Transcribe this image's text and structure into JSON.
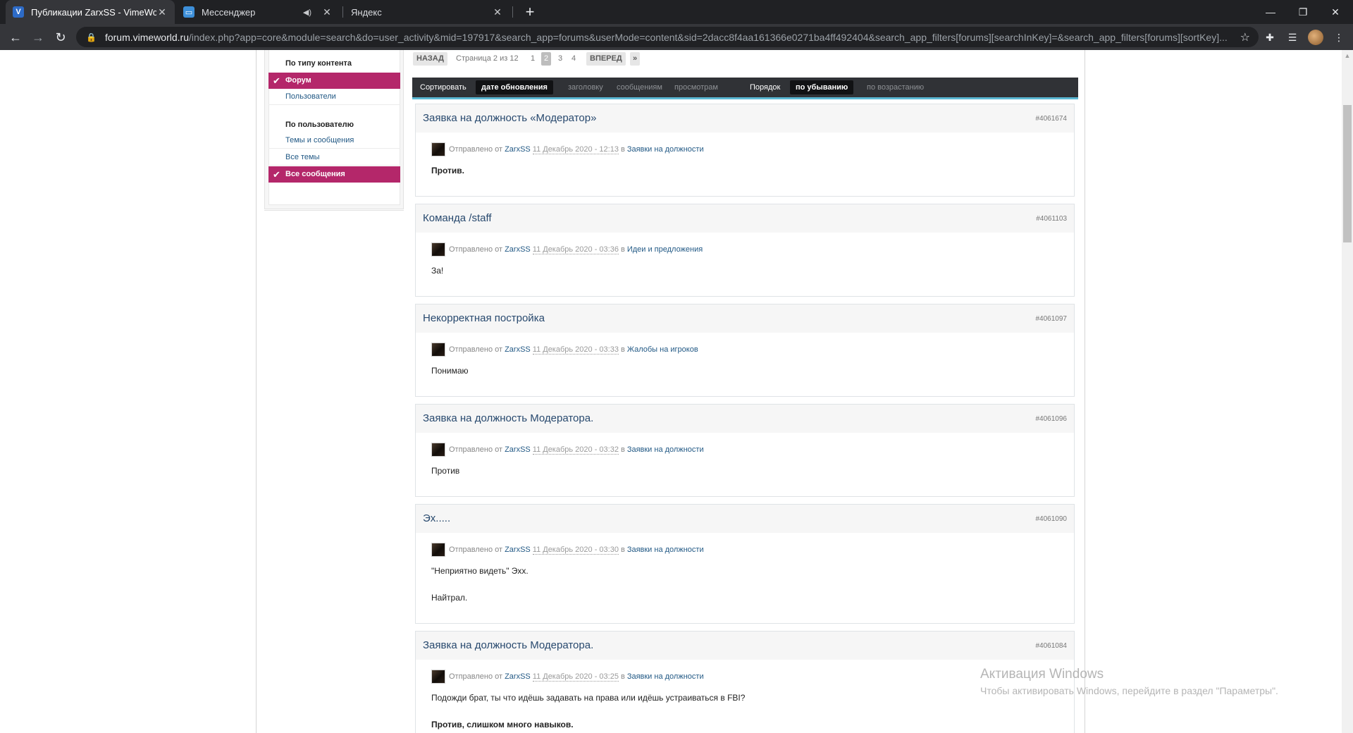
{
  "browser": {
    "tabs": [
      {
        "title": "Публикации ZarxSS - VimeWorld",
        "favicon_label": "V",
        "favicon_color": "#2d6bc7"
      },
      {
        "title": "Мессенджер",
        "favicon_label": "▭",
        "favicon_color": "#3d8fd9"
      },
      {
        "title": "Яндекс"
      }
    ],
    "address": {
      "host": "forum.vimeworld.ru",
      "path": "/index.php?app=core&module=search&do=user_activity&mid=197917&search_app=forums&userMode=content&sid=2dacc8f4aa161366e0271ba4ff492404&search_app_filters[forums][searchInKey]=&search_app_filters[forums][sortKey]..."
    }
  },
  "sidebar": {
    "content_heading": "По типу контента",
    "content_items": [
      {
        "label": "Форум",
        "selected": true
      },
      {
        "label": "Пользователи",
        "selected": false
      }
    ],
    "user_heading": "По пользователю",
    "user_items": [
      {
        "label": "Темы и сообщения",
        "selected": false
      },
      {
        "label": "Все темы",
        "selected": false
      },
      {
        "label": "Все сообщения",
        "selected": true
      }
    ]
  },
  "pagination": {
    "prev_label": "НАЗАД",
    "page_info": "Страница 2 из 12",
    "pages": [
      "1",
      "2",
      "3",
      "4"
    ],
    "current": "2",
    "next_label": "ВПЕРЕД",
    "last_label": "»"
  },
  "sort": {
    "sort_label": "Сортировать",
    "sort_options": [
      "дате обновления",
      "заголовку",
      "сообщениям",
      "просмотрам"
    ],
    "sort_active": "дате обновления",
    "order_label": "Порядок",
    "order_options": [
      "по убыванию",
      "по возрастанию"
    ],
    "order_active": "по убыванию"
  },
  "meta_labels": {
    "posted_by": "Отправлено от",
    "in": "в"
  },
  "posts": [
    {
      "title": "Заявка на должность «Модератор»",
      "id": "#4061674",
      "author": "ZarxSS",
      "date": "11 Декабрь 2020 - 12:13",
      "forum": "Заявки на должности",
      "body": [
        "Против."
      ],
      "bold": [
        true
      ]
    },
    {
      "title": "Команда /staff",
      "id": "#4061103",
      "author": "ZarxSS",
      "date": "11 Декабрь 2020 - 03:36",
      "forum": "Идеи и предложения",
      "body": [
        "За!"
      ],
      "bold": [
        false
      ]
    },
    {
      "title": "Некорректная постройка",
      "id": "#4061097",
      "author": "ZarxSS",
      "date": "11 Декабрь 2020 - 03:33",
      "forum": "Жалобы на игроков",
      "body": [
        "Понимаю"
      ],
      "bold": [
        false
      ]
    },
    {
      "title": "Заявка на должность Модератора.",
      "id": "#4061096",
      "author": "ZarxSS",
      "date": "11 Декабрь 2020 - 03:32",
      "forum": "Заявки на должности",
      "body": [
        "Против"
      ],
      "bold": [
        false
      ]
    },
    {
      "title": "Эх.....",
      "id": "#4061090",
      "author": "ZarxSS",
      "date": "11 Декабрь 2020 - 03:30",
      "forum": "Заявки на должности",
      "body": [
        "\"Неприятно видеть\" Эхх.",
        "Найтрал."
      ],
      "bold": [
        false,
        false
      ]
    },
    {
      "title": "Заявка на должность Модератора.",
      "id": "#4061084",
      "author": "ZarxSS",
      "date": "11 Декабрь 2020 - 03:25",
      "forum": "Заявки на должности",
      "body": [
        "Подожди брат, ты что идёшь задавать на права или идёшь устраиваться в FBI?",
        "Против, слишком много навыков."
      ],
      "bold": [
        false,
        true
      ]
    }
  ],
  "watermark": {
    "line1": "Активация Windows",
    "line2": "Чтобы активировать Windows, перейдите в раздел \"Параметры\"."
  }
}
